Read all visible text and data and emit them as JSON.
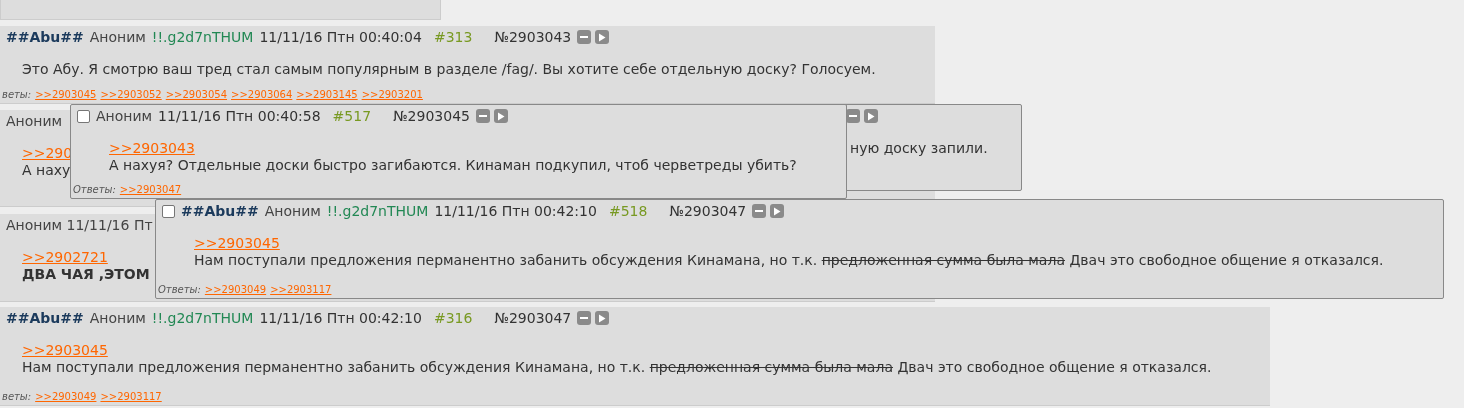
{
  "thread": [
    {
      "capcode": "##Abu##",
      "author": "Аноним",
      "trip": "!!.g2d7nTHUM",
      "date": "11/11/16 Птн 00:40:04",
      "num": "#313",
      "id": "№2903043",
      "controls": true,
      "body": [
        {
          "text": "Это Абу. Я смотрю ваш тред стал самым популярным в разделе /fag/. Вы хотите себе отдельную доску? Голосуем.",
          "struck": false
        }
      ],
      "replies_label": "веты:",
      "replies": [
        ">>2903045",
        ">>2903052",
        ">>2903054",
        ">>2903064",
        ">>2903145",
        ">>2903201"
      ]
    },
    {
      "author": "Аноним",
      "quote": ">>290",
      "body": [
        {
          "text": "А наху",
          "struck": false
        }
      ]
    },
    {
      "author": "Аноним 11/11/16 Пт",
      "quote": ">>2902721",
      "body": [
        {
          "text": "ДВА ЧАЯ ,ЭТОМ",
          "struck": false
        }
      ],
      "bold_body": true
    },
    {
      "capcode": "##Abu##",
      "author": "Аноним",
      "trip": "!!.g2d7nTHUM",
      "date": "11/11/16 Птн 00:42:10",
      "num": "#316",
      "id": "№2903047",
      "controls": true,
      "quote": ">>2903045",
      "body": [
        {
          "text": "Нам поступали предложения перманентно забанить обсуждения Кинамана, но т.к. ",
          "struck": false
        },
        {
          "text": "предложенная сумма была мала",
          "struck": true
        },
        {
          "text": " Двач это свободное общение я отказался.",
          "struck": false
        }
      ],
      "replies_label": "веты:",
      "replies": [
        ">>2903049",
        ">>2903117"
      ]
    }
  ],
  "popups": [
    {
      "checked": false,
      "author": "Аноним",
      "date": "11/11/16 Птн 00:40:58",
      "num": "#517",
      "id": "№2903045",
      "controls": true,
      "quote": ">>2903043",
      "body": [
        {
          "text": "А нахуя? Отдельные доски быстро загибаются. Кинаман подкупил, чтоб черветреды убить?",
          "struck": false
        }
      ],
      "replies_label": "Ответы:",
      "replies": [
        ">>2903047"
      ]
    },
    {
      "controls": true,
      "body": [
        {
          "text": "ную доску запили.",
          "struck": false
        }
      ]
    },
    {
      "checked": false,
      "capcode": "##Abu##",
      "author": "Аноним",
      "trip": "!!.g2d7nTHUM",
      "date": "11/11/16 Птн 00:42:10",
      "num": "#518",
      "id": "№2903047",
      "controls": true,
      "quote": ">>2903045",
      "body": [
        {
          "text": "Нам поступали предложения перманентно забанить обсуждения Кинамана, но т.к. ",
          "struck": false
        },
        {
          "text": "предложенная сумма была мала",
          "struck": true
        },
        {
          "text": " Двач это свободное общение я отказался.",
          "struck": false
        }
      ],
      "replies_label": "Ответы:",
      "replies": [
        ">>2903049",
        ">>2903117"
      ]
    }
  ]
}
